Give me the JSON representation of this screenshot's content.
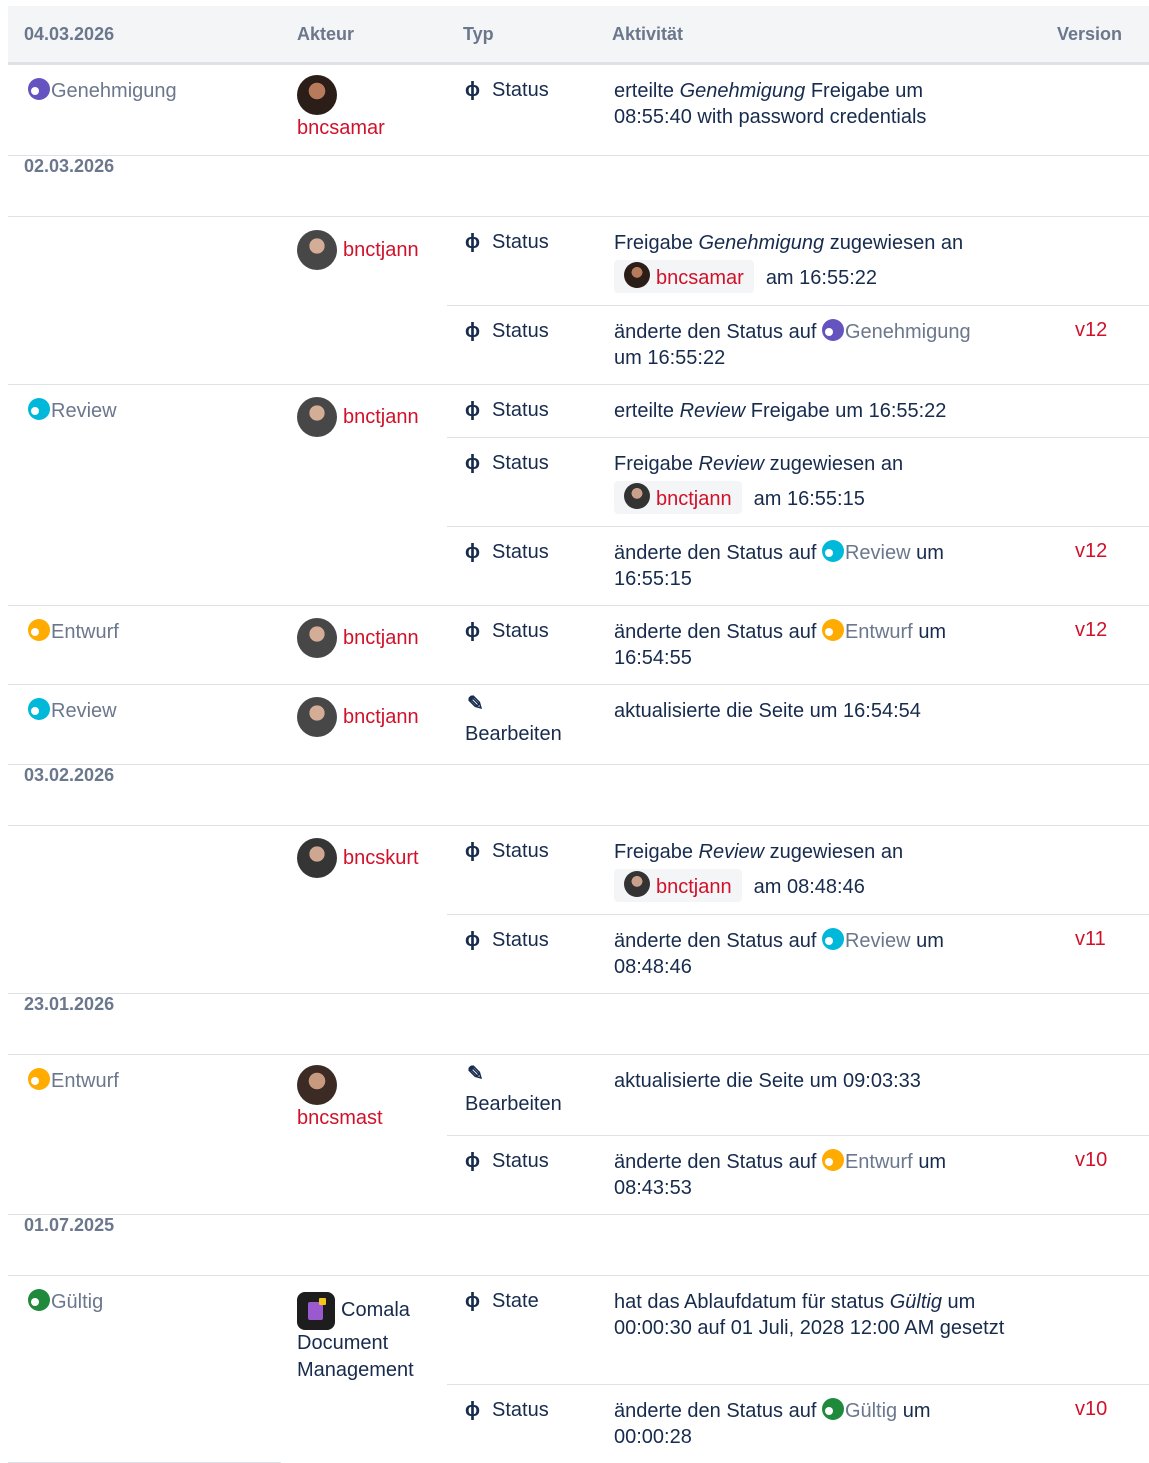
{
  "header": {
    "date": "04.03.2026",
    "actor": "Akteur",
    "type": "Typ",
    "activity": "Aktivität",
    "version": "Version"
  },
  "labels": {
    "status": "Status",
    "state": "State",
    "edit": "Bearbeiten",
    "changed_status": "änderte den Status auf",
    "assigned_prefix": "Freigabe",
    "assigned_mid": "zugewiesen an",
    "granted_prefix": "erteilte",
    "granted_mid": "Freigabe um",
    "updated_page": "aktualisierte die Seite um",
    "at": "am",
    "um": "um"
  },
  "states": {
    "genehmigung": "Genehmigung",
    "review": "Review",
    "entwurf": "Entwurf",
    "gueltig": "Gültig"
  },
  "users": {
    "bncsamar": "bncsamar",
    "bnctjann": "bnctjann",
    "bncskurt": "bncskurt",
    "bncsmast": "bncsmast",
    "comala": "Comala Document Management"
  },
  "dates": [
    "02.03.2026",
    "03.02.2026",
    "23.01.2026",
    "01.07.2025"
  ],
  "rows": {
    "r1": {
      "granted_tail": "08:55:40 with password credentials"
    },
    "r2a": {
      "time": "16:55:22"
    },
    "r2b": {
      "time": "16:55:22",
      "version": "v12"
    },
    "r3a": {
      "time": "16:55:22"
    },
    "r3b": {
      "time": "16:55:15"
    },
    "r3c": {
      "time": "16:55:15",
      "version": "v12"
    },
    "r4": {
      "time": "16:54:55",
      "version": "v12"
    },
    "r5": {
      "time": "16:54:54"
    },
    "r6a": {
      "time": "08:48:46"
    },
    "r6b": {
      "time": "08:48:46",
      "version": "v11"
    },
    "r7a": {
      "time": "09:03:33"
    },
    "r7b": {
      "time": "08:43:53",
      "version": "v10"
    },
    "r8a": {
      "text_prefix": "hat das Ablaufdatum für status",
      "text_tail": "um 00:00:30 auf 01 Juli, 2028 12:00 AM gesetzt"
    },
    "r8b": {
      "time": "00:00:28",
      "version": "v10"
    }
  },
  "colors": {
    "genehmigung": "#6554c0",
    "review": "#00b8d9",
    "entwurf": "#ffab00",
    "gueltig": "#1f8a3b",
    "link": "#d1112a"
  },
  "icons": {
    "status": "workflow-status-icon",
    "edit": "pencil-icon"
  }
}
